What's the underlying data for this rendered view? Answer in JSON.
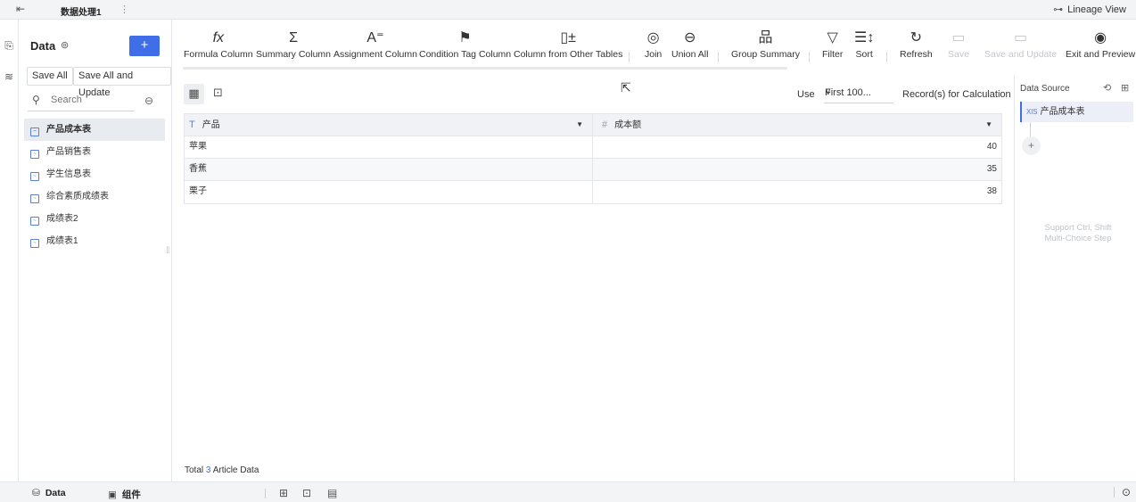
{
  "topbar": {
    "back_icon": "exit-icon",
    "title": "数据处理1",
    "more_icon": "⋮",
    "lineage_label": "Lineage View",
    "lineage_icon": "lineage-icon"
  },
  "sidebar": {
    "title": "Data",
    "add_label": "+",
    "save_all": "Save All",
    "save_all_update": "Save All and Update",
    "search_placeholder": "Search",
    "items": [
      {
        "label": "产品成本表",
        "active": true
      },
      {
        "label": "产品销售表"
      },
      {
        "label": "学生信息表"
      },
      {
        "label": "综合素质成绩表"
      },
      {
        "label": "成绩表2"
      },
      {
        "label": "成绩表1"
      }
    ]
  },
  "toolbar": {
    "formula": "Formula Column",
    "summary": "Summary Column",
    "assignment": "Assignment Column",
    "condition": "Condition Tag Column",
    "other_tables": "Column from Other Tables",
    "join": "Join",
    "union": "Union All",
    "group": "Group Summary",
    "filter": "Filter",
    "sort": "Sort",
    "refresh": "Refresh",
    "save": "Save",
    "save_update": "Save and Update",
    "exit_preview": "Exit and Preview"
  },
  "main": {
    "use_label": "Use",
    "use_value": "First 100...",
    "use_suffix": "Record(s) for Calculation",
    "columns": [
      "产品",
      "成本额"
    ],
    "rows": [
      [
        "苹果",
        "40"
      ],
      [
        "香蕉",
        "35"
      ],
      [
        "栗子",
        "38"
      ]
    ],
    "footer_prefix": "Total",
    "footer_count": "3",
    "footer_suffix": "Article Data"
  },
  "rightpanel": {
    "title": "Data Source",
    "source_badge": "XlS",
    "source_label": "产品成本表",
    "add_label": "+",
    "hint_line1": "Support Ctrl, Shift",
    "hint_line2": "Multi-Choice Step"
  },
  "bottombar": {
    "tab_data": "Data",
    "tab_components": "组件"
  },
  "colors": {
    "accent": "#3f6ee8",
    "disabled": "#c3c6cb"
  }
}
